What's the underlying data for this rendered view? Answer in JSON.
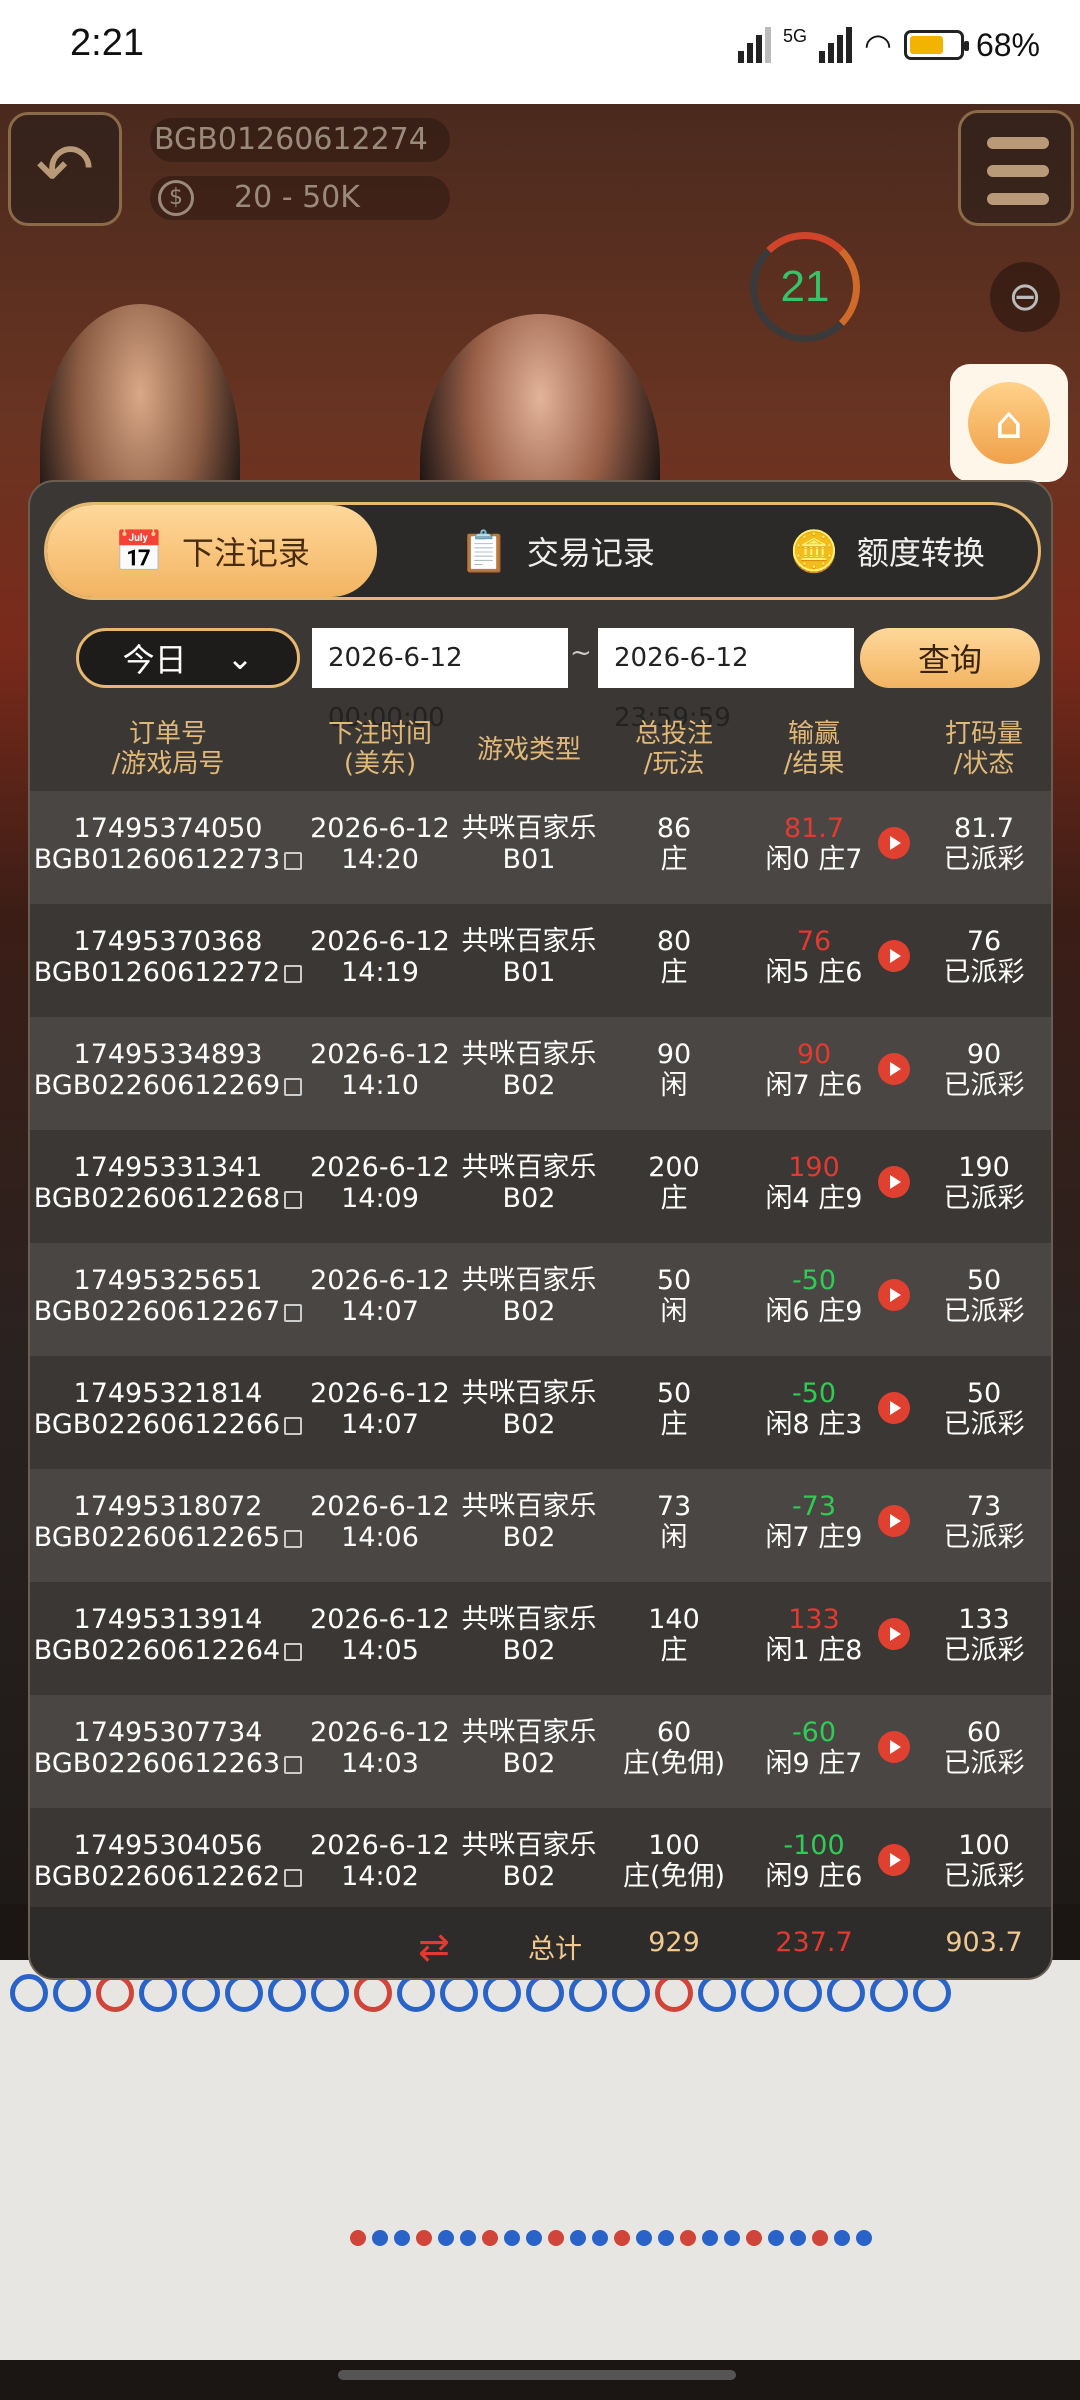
{
  "status_bar": {
    "time": "2:21",
    "network": "5G",
    "battery": "68%",
    "battery_level": 0.68
  },
  "game": {
    "room_code": "BGB01260612274",
    "limit": "20 - 50K",
    "timer": "21"
  },
  "tabs": [
    {
      "label": "下注记录",
      "icon": "calendar-icon",
      "active": true
    },
    {
      "label": "交易记录",
      "icon": "clipboard-icon",
      "active": false
    },
    {
      "label": "额度转换",
      "icon": "coins-icon",
      "active": false
    }
  ],
  "filter": {
    "day": "今日",
    "start": "2026-6-12 00:00:00",
    "separator": "~",
    "end": "2026-6-12 23:59:59",
    "query_label": "查询"
  },
  "columns": [
    [
      "订单号",
      "/游戏局号"
    ],
    [
      "下注时间",
      "(美东)"
    ],
    [
      "游戏类型",
      ""
    ],
    [
      "总投注",
      "/玩法"
    ],
    [
      "输赢",
      "/结果"
    ],
    [
      "打码量",
      "/状态"
    ]
  ],
  "rows": [
    {
      "order": "17495374050",
      "round": "BGB01260612273",
      "date": "2026-6-12",
      "time": "14:20",
      "game": "共咪百家乐",
      "table": "B01",
      "bet": "86",
      "play": "庄",
      "win": "81.7",
      "result": "闲0 庄7",
      "turnover": "81.7",
      "status": "已派彩",
      "sign": "pos"
    },
    {
      "order": "17495370368",
      "round": "BGB01260612272",
      "date": "2026-6-12",
      "time": "14:19",
      "game": "共咪百家乐",
      "table": "B01",
      "bet": "80",
      "play": "庄",
      "win": "76",
      "result": "闲5 庄6",
      "turnover": "76",
      "status": "已派彩",
      "sign": "pos"
    },
    {
      "order": "17495334893",
      "round": "BGB02260612269",
      "date": "2026-6-12",
      "time": "14:10",
      "game": "共咪百家乐",
      "table": "B02",
      "bet": "90",
      "play": "闲",
      "win": "90",
      "result": "闲7 庄6",
      "turnover": "90",
      "status": "已派彩",
      "sign": "pos"
    },
    {
      "order": "17495331341",
      "round": "BGB02260612268",
      "date": "2026-6-12",
      "time": "14:09",
      "game": "共咪百家乐",
      "table": "B02",
      "bet": "200",
      "play": "庄",
      "win": "190",
      "result": "闲4 庄9",
      "turnover": "190",
      "status": "已派彩",
      "sign": "pos"
    },
    {
      "order": "17495325651",
      "round": "BGB02260612267",
      "date": "2026-6-12",
      "time": "14:07",
      "game": "共咪百家乐",
      "table": "B02",
      "bet": "50",
      "play": "闲",
      "win": "-50",
      "result": "闲6 庄9",
      "turnover": "50",
      "status": "已派彩",
      "sign": "neg"
    },
    {
      "order": "17495321814",
      "round": "BGB02260612266",
      "date": "2026-6-12",
      "time": "14:07",
      "game": "共咪百家乐",
      "table": "B02",
      "bet": "50",
      "play": "庄",
      "win": "-50",
      "result": "闲8 庄3",
      "turnover": "50",
      "status": "已派彩",
      "sign": "neg"
    },
    {
      "order": "17495318072",
      "round": "BGB02260612265",
      "date": "2026-6-12",
      "time": "14:06",
      "game": "共咪百家乐",
      "table": "B02",
      "bet": "73",
      "play": "闲",
      "win": "-73",
      "result": "闲7 庄9",
      "turnover": "73",
      "status": "已派彩",
      "sign": "neg"
    },
    {
      "order": "17495313914",
      "round": "BGB02260612264",
      "date": "2026-6-12",
      "time": "14:05",
      "game": "共咪百家乐",
      "table": "B02",
      "bet": "140",
      "play": "庄",
      "win": "133",
      "result": "闲1 庄8",
      "turnover": "133",
      "status": "已派彩",
      "sign": "pos"
    },
    {
      "order": "17495307734",
      "round": "BGB02260612263",
      "date": "2026-6-12",
      "time": "14:03",
      "game": "共咪百家乐",
      "table": "B02",
      "bet": "60",
      "play": "庄(免佣)",
      "win": "-60",
      "result": "闲9 庄7",
      "turnover": "60",
      "status": "已派彩",
      "sign": "neg"
    },
    {
      "order": "17495304056",
      "round": "BGB02260612262",
      "date": "2026-6-12",
      "time": "14:02",
      "game": "共咪百家乐",
      "table": "B02",
      "bet": "100",
      "play": "庄(免佣)",
      "win": "-100",
      "result": "闲9 庄6",
      "turnover": "100",
      "status": "已派彩",
      "sign": "neg"
    }
  ],
  "total": {
    "label": "总计",
    "bet": "929",
    "win": "237.7",
    "turnover": "903.7"
  }
}
